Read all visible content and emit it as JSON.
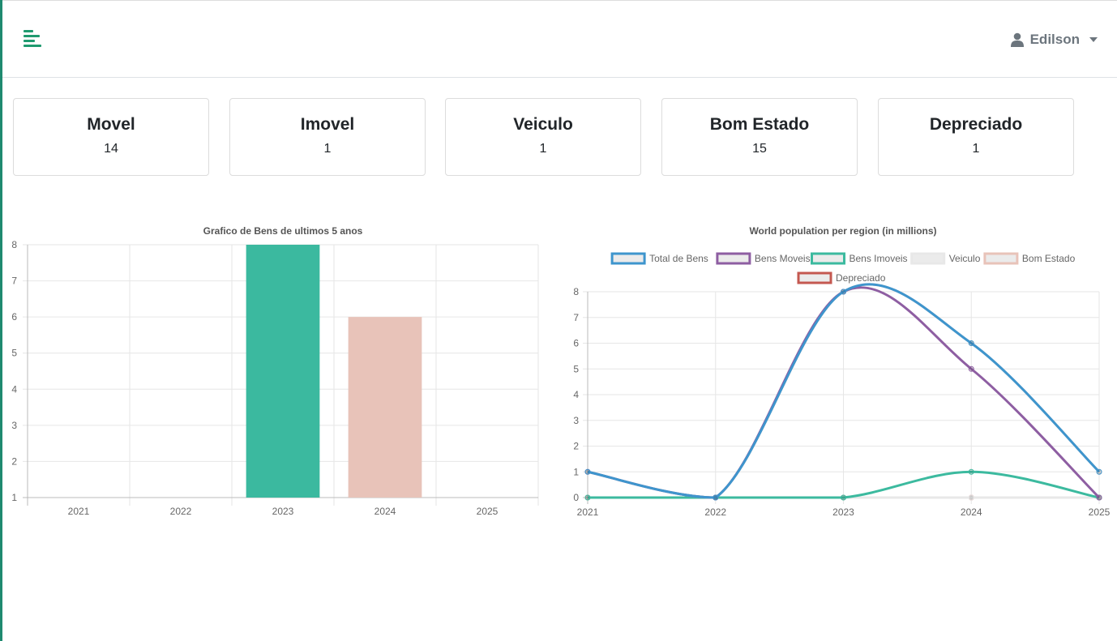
{
  "header": {
    "user_name": "Edilson",
    "menu_icon": "bars-left-icon",
    "user_icon": "user-icon",
    "accent_color": "#1f9a6f"
  },
  "cards": [
    {
      "label": "Movel",
      "value": "14"
    },
    {
      "label": "Imovel",
      "value": "1"
    },
    {
      "label": "Veiculo",
      "value": "1"
    },
    {
      "label": "Bom Estado",
      "value": "15"
    },
    {
      "label": "Depreciado",
      "value": "1"
    }
  ],
  "chart_data": [
    {
      "type": "bar",
      "title": "Grafico de Bens de ultimos 5 anos",
      "categories": [
        "2021",
        "2022",
        "2023",
        "2024",
        "2025"
      ],
      "values": [
        0,
        0,
        8,
        6,
        0
      ],
      "colors": [
        "#3bb99f",
        "#3bb99f",
        "#3bb99f",
        "#e8c3b9",
        "#e8c3b9"
      ],
      "ylim": [
        1,
        8
      ],
      "yticks": [
        "1",
        "2",
        "3",
        "4",
        "5",
        "6",
        "7",
        "8"
      ],
      "grid": true
    },
    {
      "type": "line",
      "title": "World population per region (in millions)",
      "categories": [
        "2021",
        "2022",
        "2023",
        "2024",
        "2025"
      ],
      "ylim": [
        0,
        8
      ],
      "yticks": [
        "0",
        "1",
        "2",
        "3",
        "4",
        "5",
        "6",
        "7",
        "8"
      ],
      "grid": true,
      "legend_position": "top",
      "series": [
        {
          "name": "Total de Bens",
          "values": [
            1,
            0,
            8,
            6,
            1
          ],
          "color": "#3e95cd"
        },
        {
          "name": "Bens Moveis",
          "values": [
            1,
            0,
            8,
            5,
            0
          ],
          "color": "#8e5ea2"
        },
        {
          "name": "Bens Imoveis",
          "values": [
            0,
            0,
            0,
            1,
            0
          ],
          "color": "#3cba9f"
        },
        {
          "name": "Veiculo",
          "values": [
            0,
            0,
            0,
            0,
            0
          ],
          "color": "#e8e8e8"
        },
        {
          "name": "Bom Estado",
          "values": [
            1,
            0,
            8,
            6,
            1
          ],
          "color": "#e8c3b9"
        },
        {
          "name": "Depreciado",
          "values": [
            0,
            0,
            0,
            0,
            0
          ],
          "color": "#c45850"
        }
      ]
    }
  ]
}
